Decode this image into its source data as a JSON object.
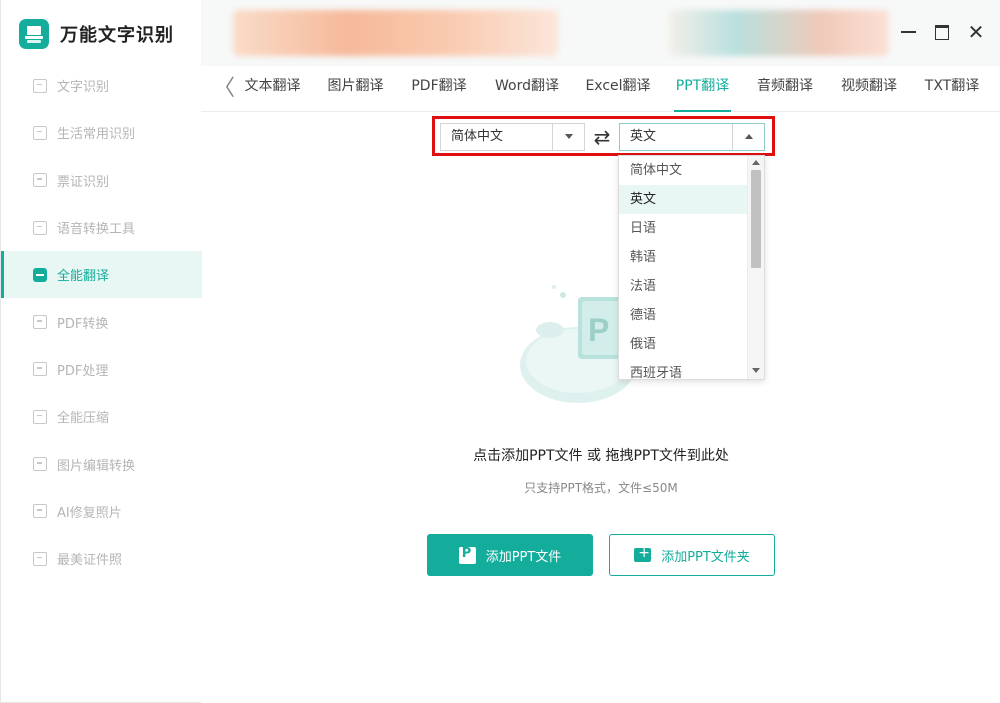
{
  "app": {
    "title": "万能文字识别"
  },
  "sidebar": {
    "items": [
      {
        "label": "文字识别",
        "icon": "scan-text-icon"
      },
      {
        "label": "生活常用识别",
        "icon": "scan-life-icon"
      },
      {
        "label": "票证识别",
        "icon": "scan-ticket-icon"
      },
      {
        "label": "语音转换工具",
        "icon": "audio-tool-icon"
      },
      {
        "label": "全能翻译",
        "icon": "translate-icon",
        "active": true
      },
      {
        "label": "PDF转换",
        "icon": "pdf-convert-icon"
      },
      {
        "label": "PDF处理",
        "icon": "pdf-process-icon"
      },
      {
        "label": "全能压缩",
        "icon": "compress-icon"
      },
      {
        "label": "图片编辑转换",
        "icon": "image-edit-icon"
      },
      {
        "label": "AI修复照片",
        "icon": "ai-repair-icon"
      },
      {
        "label": "最美证件照",
        "icon": "id-photo-icon"
      }
    ]
  },
  "window": {
    "close_symbol": "✕"
  },
  "tabs": {
    "back_symbol": "〈",
    "items": [
      {
        "label": "文本翻译"
      },
      {
        "label": "图片翻译"
      },
      {
        "label": "PDF翻译"
      },
      {
        "label": "Word翻译"
      },
      {
        "label": "Excel翻译"
      },
      {
        "label": "PPT翻译",
        "active": true
      },
      {
        "label": "音频翻译"
      },
      {
        "label": "视频翻译"
      },
      {
        "label": "TXT翻译"
      }
    ]
  },
  "language": {
    "source": "简体中文",
    "target": "英文",
    "swap_symbol": "⇄",
    "options": [
      "简体中文",
      "英文",
      "日语",
      "韩语",
      "法语",
      "德语",
      "俄语",
      "西班牙语"
    ],
    "selected_option": "英文"
  },
  "upload": {
    "hint": "点击添加PPT文件 或 拖拽PPT文件到此处",
    "sub_hint": "只支持PPT格式，文件≤50M",
    "add_file_label": "添加PPT文件",
    "add_folder_label": "添加PPT文件夹"
  },
  "colors": {
    "accent": "#14ad9c",
    "highlight_border": "#e00e0e",
    "active_bg": "#e8f6f4"
  }
}
